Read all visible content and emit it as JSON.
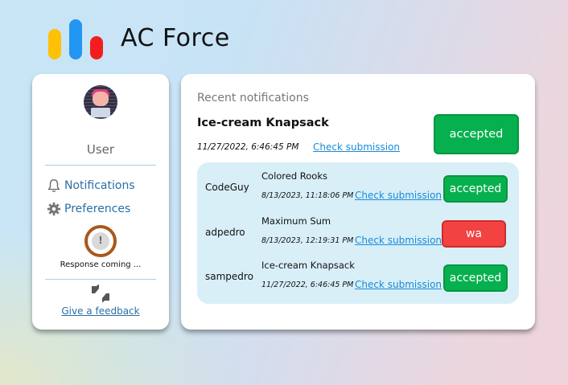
{
  "brand": {
    "name": "AC Force",
    "colors": [
      "#ffc107",
      "#2196f3",
      "#f41d1d"
    ]
  },
  "sidebar": {
    "username": "User",
    "links": {
      "notifications": "Notifications",
      "preferences": "Preferences"
    },
    "status": {
      "icon": "!",
      "text": "Response coming ..."
    },
    "feedback": "Give a feedback",
    "icons": [
      "bell-icon",
      "gear-icon",
      "thumbs-icon"
    ]
  },
  "main": {
    "title": "Recent notifications",
    "top": {
      "problem": "Ice-cream Knapsack",
      "time": "11/27/2022, 6:46:45 PM",
      "check": "Check submission",
      "verdict": "accepted"
    },
    "rows": [
      {
        "user": "CodeGuy",
        "problem": "Colored Rooks",
        "time": "8/13/2023, 11:18:06 PM",
        "check": "Check submission",
        "verdict": "accepted"
      },
      {
        "user": "adpedro",
        "problem": "Maximum Sum",
        "time": "8/13/2023, 12:19:31 PM",
        "check": "Check submission",
        "verdict": "wa"
      },
      {
        "user": "sampedro",
        "problem": "Ice-cream Knapsack",
        "time": "11/27/2022, 6:46:45 PM",
        "check": "Check submission",
        "verdict": "accepted"
      }
    ],
    "colors": {
      "accepted": "#07b04f",
      "wa": "#f24242",
      "link": "#1a8ad6"
    }
  }
}
